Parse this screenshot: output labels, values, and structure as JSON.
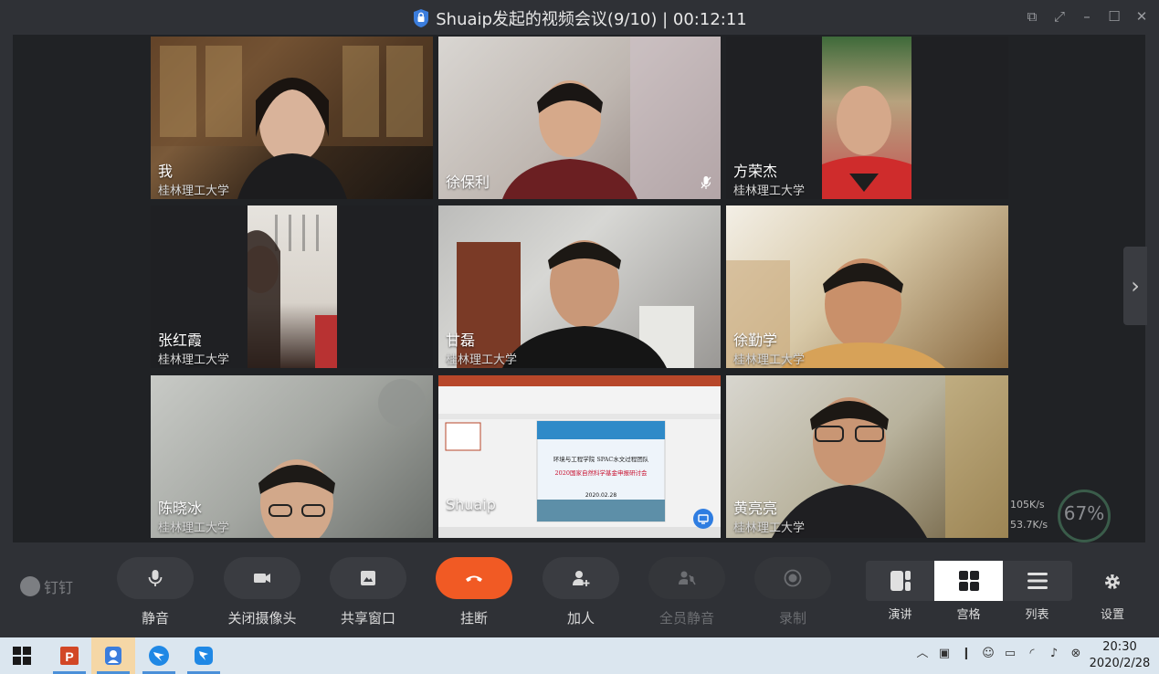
{
  "window": {
    "title": "Shuaip发起的视频会议(9/10) | 00:12:11"
  },
  "participants": [
    {
      "name": "我",
      "org": "桂林理工大学"
    },
    {
      "name": "徐保利",
      "org": ""
    },
    {
      "name": "方荣杰",
      "org": "桂林理工大学"
    },
    {
      "name": "张红霞",
      "org": "桂林理工大学"
    },
    {
      "name": "甘磊",
      "org": "桂林理工大学"
    },
    {
      "name": "徐勤学",
      "org": "桂林理工大学"
    },
    {
      "name": "陈晓冰",
      "org": "桂林理工大学"
    },
    {
      "name": "Shuaip",
      "org": ""
    },
    {
      "name": "黄亮亮",
      "org": "桂林理工大学"
    }
  ],
  "shared_slide": {
    "line1": "环境与工程学院 SPAC水文过程团队",
    "line2": "2020国家自然科学基金申报研讨会",
    "date": "2020.02.28"
  },
  "network": {
    "up": "105K/s",
    "down": "53.7K/s",
    "quality": "67%"
  },
  "brand": "钉钉",
  "toolbar": {
    "mute": "静音",
    "camera_off": "关闭摄像头",
    "share": "共享窗口",
    "hangup": "挂断",
    "add": "加人",
    "mute_all": "全员静音",
    "record": "录制"
  },
  "views": {
    "speaker": "演讲",
    "grid": "宫格",
    "list": "列表",
    "settings": "设置"
  },
  "taskbar": {
    "time": "20:30",
    "date": "2020/2/28"
  },
  "colors": {
    "hangup": "#f15a24",
    "background": "#2f3136"
  }
}
